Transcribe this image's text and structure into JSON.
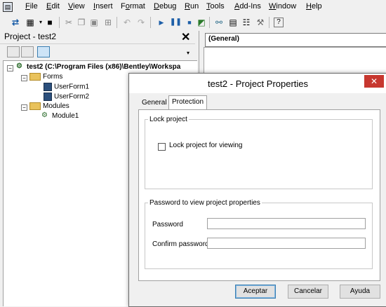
{
  "menubar": {
    "items": [
      {
        "label": "File",
        "ul": "F",
        "rest": "ile"
      },
      {
        "label": "Edit",
        "ul": "E",
        "rest": "dit"
      },
      {
        "label": "View",
        "ul": "V",
        "rest": "iew"
      },
      {
        "label": "Insert",
        "ul": "I",
        "rest": "nsert"
      },
      {
        "label": "Format",
        "pre": "F",
        "ul": "o",
        "rest": "rmat"
      },
      {
        "label": "Debug",
        "ul": "D",
        "rest": "ebug"
      },
      {
        "label": "Run",
        "ul": "R",
        "rest": "un"
      },
      {
        "label": "Tools",
        "ul": "T",
        "rest": "ools"
      },
      {
        "label": "Add-Ins",
        "ul": "A",
        "rest": "dd-Ins"
      },
      {
        "label": "Window",
        "ul": "W",
        "rest": "indow"
      },
      {
        "label": "Help",
        "ul": "H",
        "rest": "elp"
      }
    ]
  },
  "project": {
    "title": "Project - test2",
    "root": "test2 (C:\\Program Files (x86)\\Bentley\\Workspa",
    "forms_folder": "Forms",
    "forms": [
      "UserForm1",
      "UserForm2"
    ],
    "modules_folder": "Modules",
    "modules": [
      "Module1"
    ]
  },
  "code": {
    "object_combo": "(General)"
  },
  "dialog": {
    "title": "test2 - Project Properties",
    "close": "✕",
    "tabs": {
      "general": "General",
      "protection": "Protection"
    },
    "lock_group": "Lock project",
    "lock_checkbox_label": "Lock project for viewing",
    "lock_checked": false,
    "password_group": "Password to view project properties",
    "password_label": "Password",
    "confirm_label": "Confirm password",
    "password_value": "",
    "confirm_value": "",
    "buttons": {
      "ok": "Aceptar",
      "cancel": "Cancelar",
      "help": "Ayuda"
    }
  },
  "colors": {
    "close_button": "#c7372f",
    "accent_button_border": "#3c7fb1"
  }
}
